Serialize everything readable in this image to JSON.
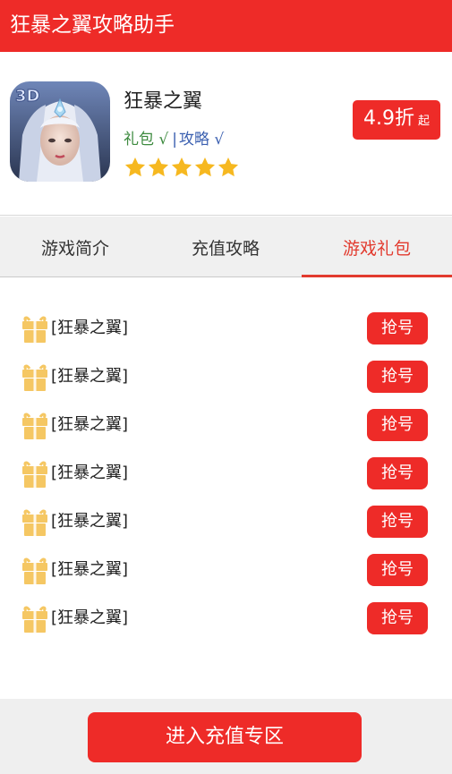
{
  "header": {
    "title": "狂暴之翼攻略助手"
  },
  "app": {
    "name": "狂暴之翼",
    "icon": "game-character-icon",
    "tag_gift": "礼包 √",
    "tag_separator": "|",
    "tag_guide": "攻略 √",
    "rating_stars": 5,
    "discount_value": "4.9折",
    "discount_suffix": "起"
  },
  "tabs": [
    {
      "label": "游戏简介",
      "active": false
    },
    {
      "label": "充值攻略",
      "active": false
    },
    {
      "label": "游戏礼包",
      "active": true
    }
  ],
  "gifts": [
    {
      "name": "[狂暴之翼]",
      "button": "抢号"
    },
    {
      "name": "[狂暴之翼]",
      "button": "抢号"
    },
    {
      "name": "[狂暴之翼]",
      "button": "抢号"
    },
    {
      "name": "[狂暴之翼]",
      "button": "抢号"
    },
    {
      "name": "[狂暴之翼]",
      "button": "抢号"
    },
    {
      "name": "[狂暴之翼]",
      "button": "抢号"
    },
    {
      "name": "[狂暴之翼]",
      "button": "抢号"
    }
  ],
  "footer": {
    "button_label": "进入充值专区"
  },
  "colors": {
    "brand_red": "#ee2b28",
    "active_tab": "#e23a2e",
    "star": "#f6b820",
    "gift_icon": "#f5c763"
  }
}
